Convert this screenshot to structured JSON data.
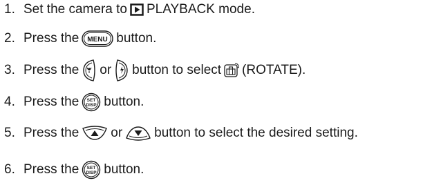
{
  "steps": [
    {
      "number": "1.",
      "parts": [
        "Set the camera to",
        "PLAYBACK mode."
      ],
      "icons": [
        "playback-mode-icon"
      ]
    },
    {
      "number": "2.",
      "parts": [
        "Press the",
        "button."
      ],
      "icons": [
        "menu-button-icon"
      ],
      "icon_text": "MENU"
    },
    {
      "number": "3.",
      "parts": [
        "Press the",
        "or",
        "button to select",
        "(ROTATE)."
      ],
      "icons": [
        "macro-left-button-icon",
        "flash-right-button-icon",
        "rotate-icon"
      ]
    },
    {
      "number": "4.",
      "parts": [
        "Press the",
        "button."
      ],
      "icons": [
        "set-disp-button-icon"
      ],
      "icon_text": [
        "SET",
        "DISP"
      ]
    },
    {
      "number": "5.",
      "parts": [
        "Press the",
        "or",
        "button to select the desired setting."
      ],
      "icons": [
        "up-button-icon",
        "down-button-icon"
      ]
    },
    {
      "number": "6.",
      "parts": [
        "Press the",
        "button."
      ],
      "icons": [
        "set-disp-button-icon"
      ],
      "icon_text": [
        "SET",
        "DISP"
      ]
    }
  ]
}
